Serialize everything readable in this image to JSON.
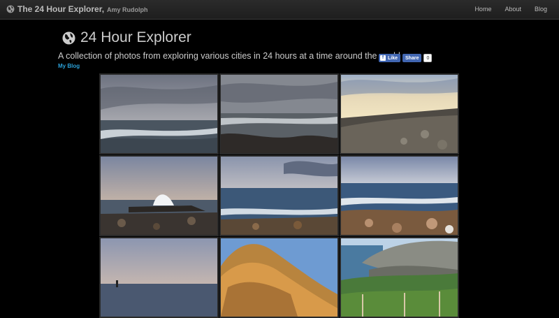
{
  "navbar": {
    "brand_title": "The 24 Hour Explorer,",
    "brand_author": "Amy Rudolph",
    "links": [
      "Home",
      "About",
      "Blog"
    ]
  },
  "header": {
    "title": "24 Hour Explorer",
    "subtitle": "A collection of photos from exploring various cities in 24 hours at a time around the world",
    "blog_link": "My Blog"
  },
  "social": {
    "like_label": "Like",
    "share_label": "Share",
    "share_count": "0"
  },
  "colors": {
    "link": "#2a9fd6",
    "facebook": "#4267b2"
  },
  "gallery": {
    "photos": [
      {
        "scene": "overcast-ocean-waves"
      },
      {
        "scene": "grey-ocean-rocky-shore"
      },
      {
        "scene": "sunset-rocky-coast"
      },
      {
        "scene": "wave-splash-on-rocks"
      },
      {
        "scene": "calm-sea-rocky-beach"
      },
      {
        "scene": "waves-on-pebble-beach"
      },
      {
        "scene": "dusk-sea-figure"
      },
      {
        "scene": "orange-rock-cliff"
      },
      {
        "scene": "coastal-cliff-vegetation"
      }
    ]
  }
}
